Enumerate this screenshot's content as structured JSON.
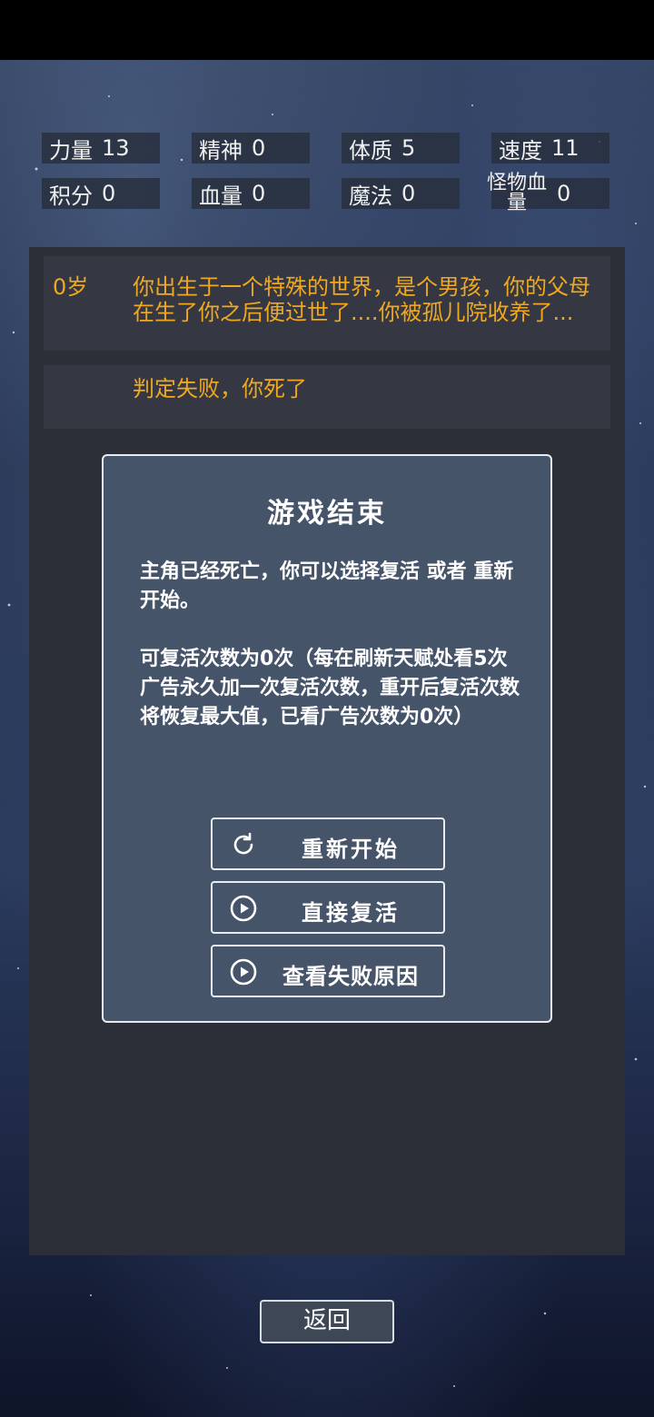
{
  "stats": [
    {
      "label": "力量",
      "value": "13"
    },
    {
      "label": "精神",
      "value": "0"
    },
    {
      "label": "体质",
      "value": "5"
    },
    {
      "label": "速度",
      "value": "11"
    },
    {
      "label": "积分",
      "value": "0"
    },
    {
      "label": "血量",
      "value": "0"
    },
    {
      "label": "魔法",
      "value": "0"
    },
    {
      "label": "怪物血量",
      "value": "0"
    }
  ],
  "log": [
    {
      "age": "0岁",
      "text": "你出生于一个特殊的世界，是个男孩，你的父母在生了你之后便过世了....你被孤儿院收养了..."
    },
    {
      "age": "",
      "text": "判定失败，你死了"
    }
  ],
  "dialog": {
    "title": "游戏结束",
    "message": "主角已经死亡，你可以选择复活 或者 重新开始。",
    "revive_info": "可复活次数为0次（每在刷新天赋处看5次广告永久加一次复活次数，重开后复活次数将恢复最大值，已看广告次数为0次）",
    "buttons": [
      {
        "label": "重新开始",
        "icon": "refresh-icon"
      },
      {
        "label": "直接复活",
        "icon": "play-circle-icon"
      },
      {
        "label": "查看失败原因",
        "icon": "play-circle-icon"
      }
    ]
  },
  "back_button": "返回"
}
